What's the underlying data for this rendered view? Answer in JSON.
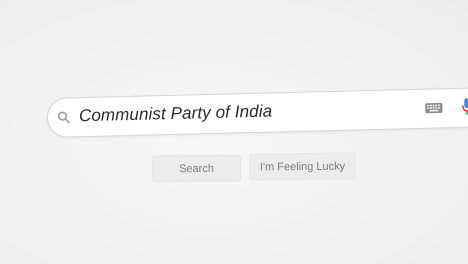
{
  "search": {
    "query": "Communist Party of India"
  },
  "buttons": {
    "search_label": "Search",
    "lucky_label": "I'm Feeling Lucky"
  },
  "icons": {
    "search": "search-icon",
    "keyboard": "keyboard-icon",
    "mic": "microphone-icon"
  },
  "colors": {
    "page_background": "#f2f2f2",
    "search_box": "#ffffff",
    "button_background": "#ececec",
    "button_text": "#7a7a7a",
    "query_text": "#2a2a2a",
    "mic_blue": "#4285f4",
    "mic_red": "#ea4335"
  }
}
